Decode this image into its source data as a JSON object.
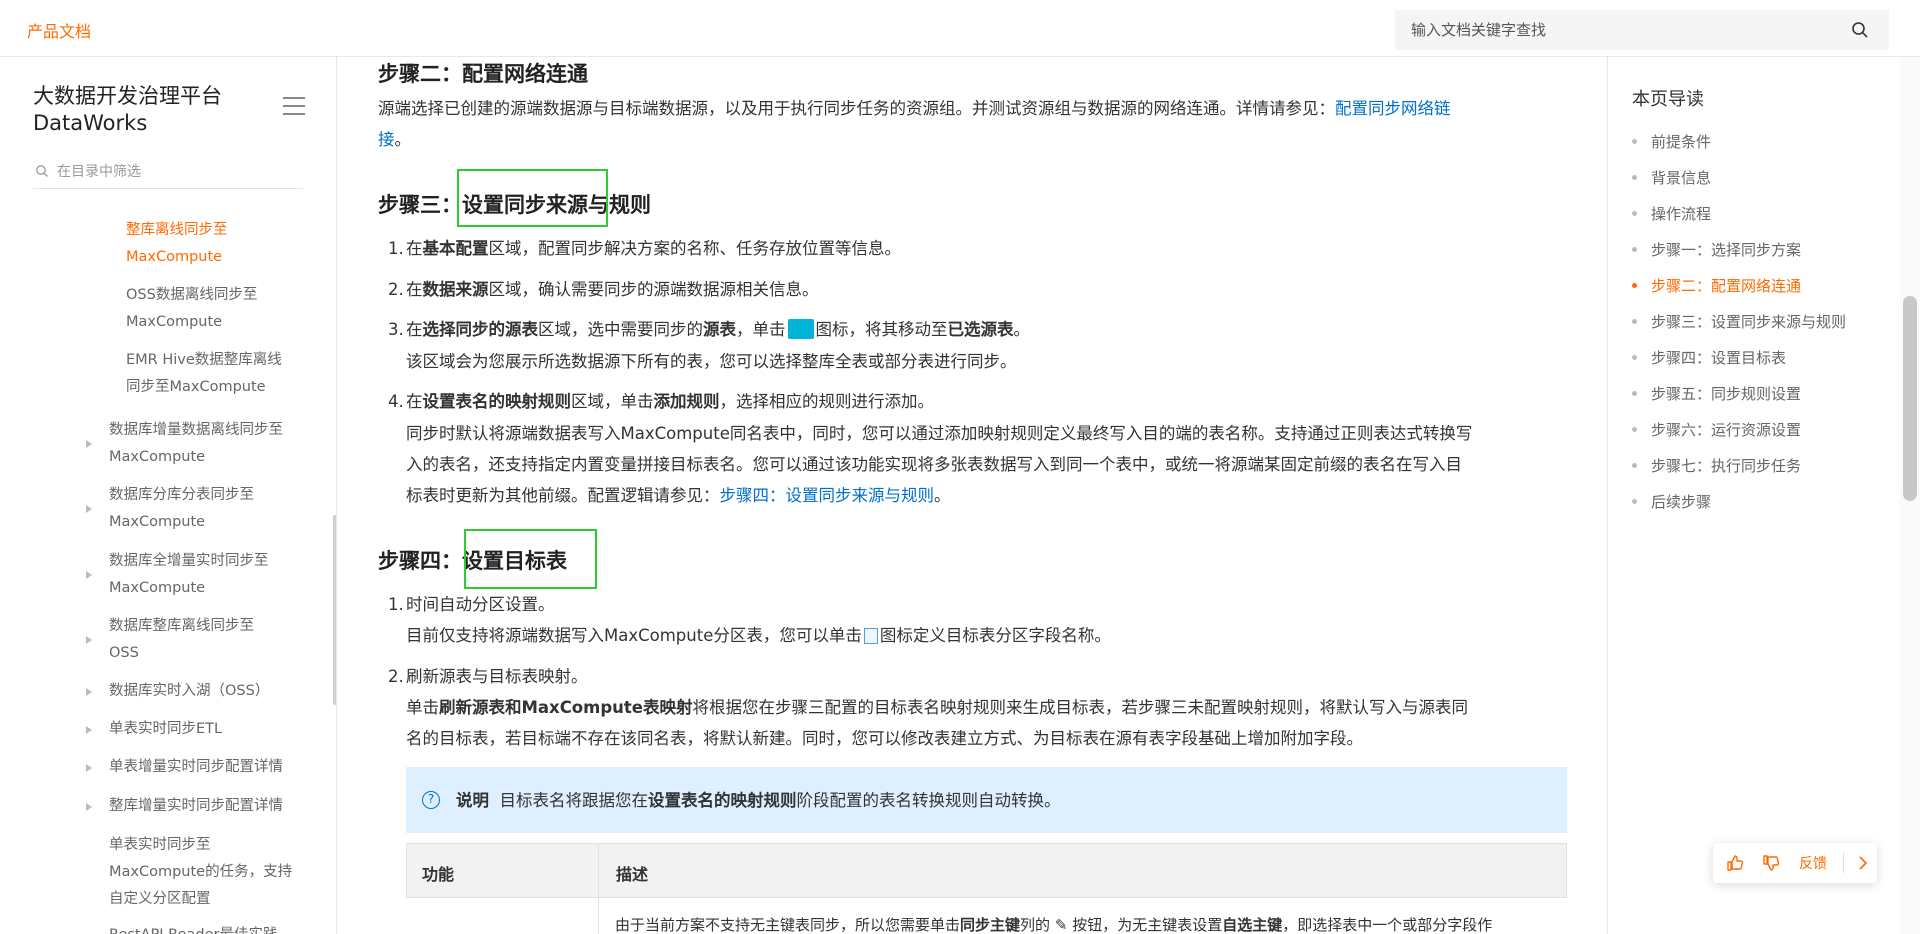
{
  "header": {
    "brand": "产品文档",
    "search_placeholder": "输入文档关键字查找"
  },
  "sidebar": {
    "title": "大数据开发治理平台 DataWorks",
    "filter_placeholder": "在目录中筛选",
    "items": [
      {
        "label_l1": "整库离线同步至",
        "label_l2": "MaxCompute",
        "active": true
      },
      {
        "label_l1": "OSS数据离线同步至",
        "label_l2": "MaxCompute"
      },
      {
        "label_l1": "EMR Hive数据整库离线",
        "label_l2": "同步至MaxCompute"
      },
      {
        "label_l1": "数据库增量数据离线同步至",
        "label_l2": "MaxCompute"
      },
      {
        "label_l1": "数据库分库分表同步至",
        "label_l2": "MaxCompute"
      },
      {
        "label_l1": "数据库全增量实时同步至",
        "label_l2": "MaxCompute"
      },
      {
        "label_l1": "数据库整库离线同步至",
        "label_l2": "OSS"
      },
      {
        "label_l1": "数据库实时入湖（OSS）"
      },
      {
        "label_l1": "单表实时同步ETL"
      },
      {
        "label_l1": "单表增量实时同步配置详情"
      },
      {
        "label_l1": "整库增量实时同步配置详情"
      },
      {
        "label_l1": "单表实时同步至",
        "label_l2": "MaxCompute的任务，支持",
        "label_l3": "自定义分区配置"
      },
      {
        "label_l1": "RestAPI Reader最佳实践"
      }
    ]
  },
  "content": {
    "step2": {
      "heading": "步骤二：配置网络连通",
      "text": "源端选择已创建的源端数据源与目标端数据源，以及用于执行同步任务的资源组。并测试资源组与数据源的网络连通。详情请参见：",
      "link_a": "配置同步网络链",
      "link_b": "接",
      "period": "。"
    },
    "step3": {
      "heading_prefix": "步骤三：",
      "heading_main": "设置同步来源与规则",
      "items": [
        {
          "num": "1.",
          "pre": "在",
          "b1": "基本配置",
          "post": "区域，配置同步解决方案的名称、任务存放位置等信息。"
        },
        {
          "num": "2.",
          "pre": "在",
          "b1": "数据来源",
          "post": "区域，确认需要同步的源端数据源相关信息。"
        },
        {
          "num": "3.",
          "pre": "在",
          "b1": "选择同步的源表",
          "mid1": "区域，选中需要同步的",
          "b2": "源表",
          "mid2": "，单击",
          "mid3": "图标，将其移动至",
          "b3": "已选源表",
          "end": "。",
          "sub": "该区域会为您展示所选数据源下所有的表，您可以选择整库全表或部分表进行同步。"
        },
        {
          "num": "4.",
          "pre": "在",
          "b1": "设置表名的映射规则",
          "mid1": "区域，单击",
          "b2": "添加规则",
          "end": "，选择相应的规则进行添加。",
          "sub1": "同步时默认将源端数据表写入MaxCompute同名表中，同时，您可以通过添加映射规则定义最终写入目的端的表名称。支持通过正则表达式转换写",
          "sub2": "入的表名，还支持指定内置变量拼接目标表名。您可以通过该功能实现将多张表数据写入到同一个表中，或统一将源端某固定前缀的表名在写入目",
          "sub3": "标表时更新为其他前缀。配置逻辑请参见：",
          "link": "步骤四：设置同步来源与规则",
          "period": "。"
        }
      ]
    },
    "step4": {
      "heading_prefix": "步骤四：",
      "heading_main": "设置目标表",
      "items": [
        {
          "num": "1.",
          "text": "时间自动分区设置。",
          "sub_pre": "目前仅支持将源端数据写入MaxCompute分区表，您可以单击",
          "sub_post": "图标定义目标表分区字段名称。"
        },
        {
          "num": "2.",
          "text": "刷新源表与目标表映射。",
          "sub_pre": "单击",
          "sub_b": "刷新源表和MaxCompute表映射",
          "sub_post": "将根据您在步骤三配置的目标表名映射规则来生成目标表，若步骤三未配置映射规则，将默认写入与源表同",
          "sub2": "名的目标表，若目标端不存在该同名表，将默认新建。同时，您可以修改表建立方式、为目标表在源有表字段基础上增加附加字段。"
        }
      ]
    },
    "note": {
      "label": "说明",
      "pre": "目标表名将跟据您在",
      "bold": "设置表名的映射规则",
      "post": "阶段配置的表名转换规则自动转换。"
    },
    "table": {
      "headers": [
        "功能",
        "描述"
      ],
      "row_pre": "由于当前方案不支持无主键表同步，所以您需要单击",
      "row_b1": "同步主键",
      "row_mid": "列的",
      "row_mid2": "按钮，为无主键表设置",
      "row_b2": "自选主键",
      "row_post": "，即选择表中一个或部分字段作"
    }
  },
  "toc": {
    "title": "本页导读",
    "items": [
      {
        "label": "前提条件"
      },
      {
        "label": "背景信息"
      },
      {
        "label": "操作流程"
      },
      {
        "label": "步骤一：选择同步方案"
      },
      {
        "label": "步骤二：配置网络连通",
        "active": true
      },
      {
        "label": "步骤三：设置同步来源与规则"
      },
      {
        "label": "步骤四：设置目标表"
      },
      {
        "label": "步骤五：同步规则设置"
      },
      {
        "label": "步骤六：运行资源设置"
      },
      {
        "label": "步骤七：执行同步任务"
      },
      {
        "label": "后续步骤"
      }
    ]
  },
  "feedback": {
    "label": "反馈"
  },
  "colors": {
    "brand": "#ff6a00",
    "link": "#0070cc",
    "highlight_box": "#2ecc2e",
    "note_bg": "#def0ff"
  }
}
